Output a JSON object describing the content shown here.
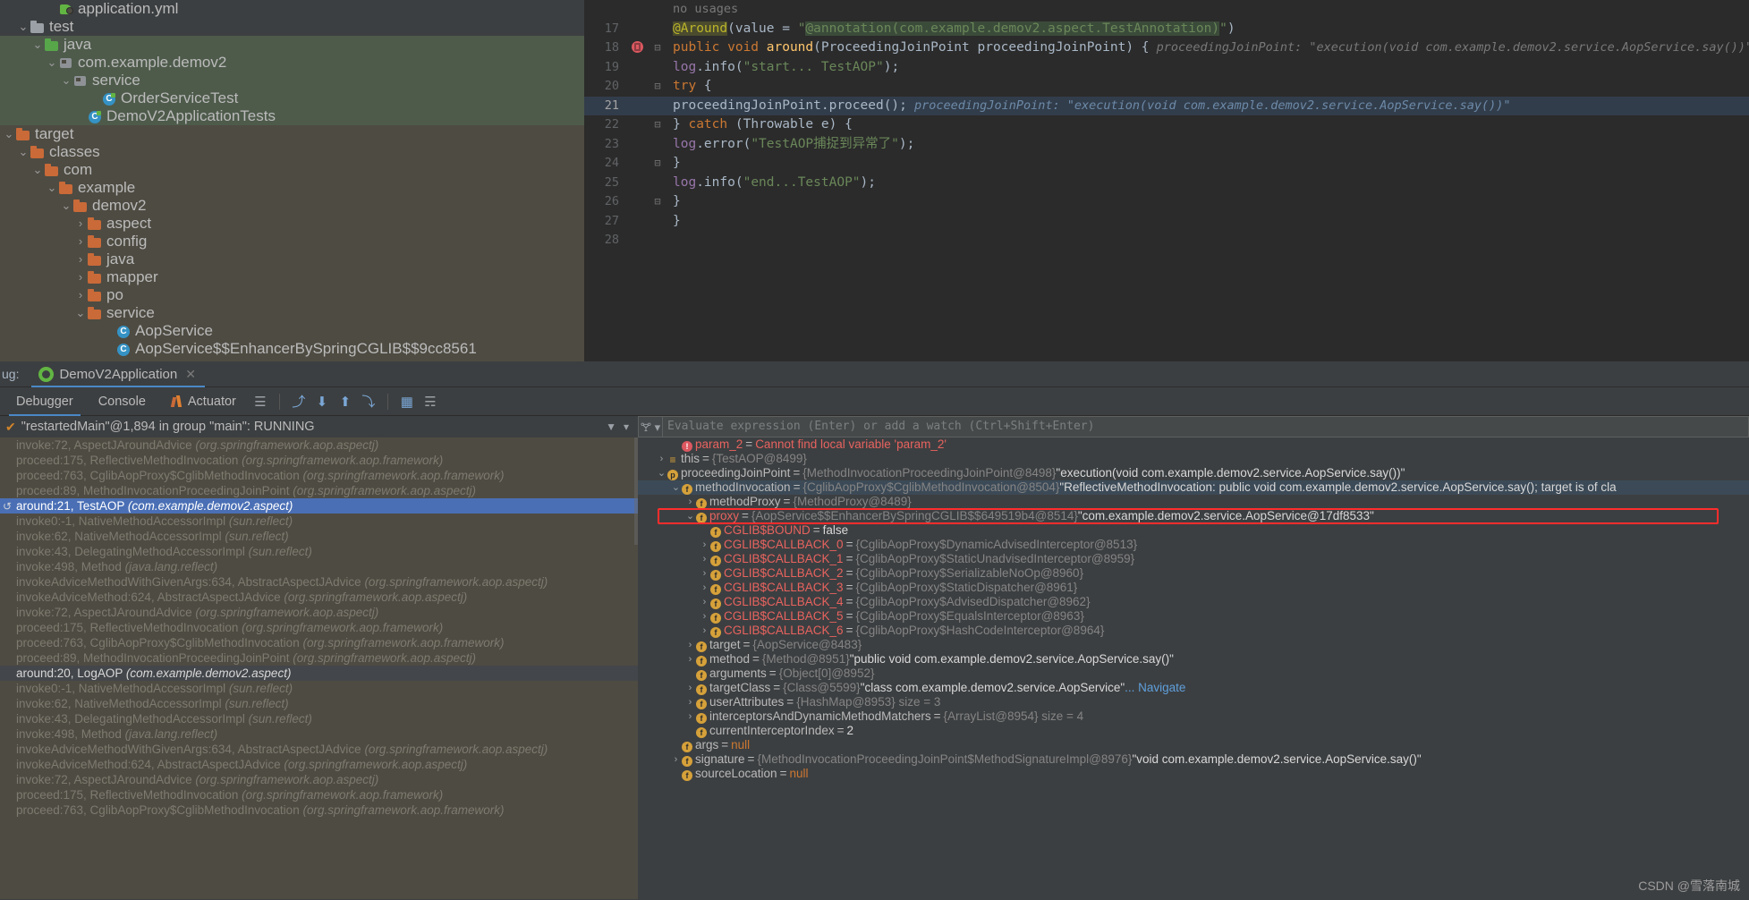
{
  "project_tree": [
    {
      "indent": 3,
      "icon": "yml-file-icon",
      "label": "application.yml",
      "chevron": "",
      "bg": "dark"
    },
    {
      "indent": 1,
      "icon": "folder-gray-icon",
      "label": "test",
      "chevron": "v",
      "bg": "dark"
    },
    {
      "indent": 2,
      "icon": "folder-green-icon",
      "label": "java",
      "chevron": "v",
      "bg": "green"
    },
    {
      "indent": 3,
      "icon": "package-icon",
      "label": "com.example.demov2",
      "chevron": "v",
      "bg": "green"
    },
    {
      "indent": 4,
      "icon": "package-icon",
      "label": "service",
      "chevron": "v",
      "bg": "green"
    },
    {
      "indent": 6,
      "icon": "class-test-icon",
      "label": "OrderServiceTest",
      "chevron": "",
      "bg": "green"
    },
    {
      "indent": 5,
      "icon": "class-test-icon",
      "label": "DemoV2ApplicationTests",
      "chevron": "",
      "bg": "green"
    },
    {
      "indent": 0,
      "icon": "folder-orange-icon",
      "label": "target",
      "chevron": "v",
      "bg": "brown"
    },
    {
      "indent": 1,
      "icon": "folder-orange-icon",
      "label": "classes",
      "chevron": "v",
      "bg": "brown"
    },
    {
      "indent": 2,
      "icon": "folder-orange-icon",
      "label": "com",
      "chevron": "v",
      "bg": "brown"
    },
    {
      "indent": 3,
      "icon": "folder-orange-icon",
      "label": "example",
      "chevron": "v",
      "bg": "brown"
    },
    {
      "indent": 4,
      "icon": "folder-orange-icon",
      "label": "demov2",
      "chevron": "v",
      "bg": "brown"
    },
    {
      "indent": 5,
      "icon": "folder-orange-icon",
      "label": "aspect",
      "chevron": ">",
      "bg": "brown"
    },
    {
      "indent": 5,
      "icon": "folder-orange-icon",
      "label": "config",
      "chevron": ">",
      "bg": "brown"
    },
    {
      "indent": 5,
      "icon": "folder-orange-icon",
      "label": "java",
      "chevron": ">",
      "bg": "brown"
    },
    {
      "indent": 5,
      "icon": "folder-orange-icon",
      "label": "mapper",
      "chevron": ">",
      "bg": "brown"
    },
    {
      "indent": 5,
      "icon": "folder-orange-icon",
      "label": "po",
      "chevron": ">",
      "bg": "brown"
    },
    {
      "indent": 5,
      "icon": "folder-orange-icon",
      "label": "service",
      "chevron": "v",
      "bg": "brown"
    },
    {
      "indent": 7,
      "icon": "class-icon",
      "label": "AopService",
      "chevron": "",
      "bg": "brown"
    },
    {
      "indent": 7,
      "icon": "class-icon",
      "label": "AopService$$EnhancerBySpringCGLIB$$9cc8561",
      "chevron": "",
      "bg": "brown"
    }
  ],
  "editor": {
    "no_usages_hint": "no usages",
    "lines": [
      {
        "num": "",
        "text_html": "",
        "kind": "hintline",
        "hint": "no usages"
      },
      {
        "num": "17",
        "kind": "code",
        "segments": [
          {
            "t": "@Around",
            "c": "anhl"
          },
          {
            "t": "(value = ",
            "c": "id"
          },
          {
            "t": "\"",
            "c": "s"
          },
          {
            "t": "@annotation(com.example.demov2.aspect.TestAnnotation)",
            "c": "s ann-hl"
          },
          {
            "t": "\"",
            "c": "s"
          },
          {
            "t": ")",
            "c": "id"
          }
        ]
      },
      {
        "num": "18",
        "kind": "code",
        "breakpoint": true,
        "fold": "-",
        "segments": [
          {
            "t": "public void ",
            "c": "k"
          },
          {
            "t": "around",
            "c": "fnd"
          },
          {
            "t": "(ProceedingJoinPoint proceedingJoinPoint) {",
            "c": "id"
          }
        ],
        "inlay": "proceedingJoinPoint: \"execution(void com.example.demov2.service.AopService.say())\""
      },
      {
        "num": "19",
        "kind": "code",
        "segments": [
          {
            "t": "    ",
            "c": "id"
          },
          {
            "t": "log",
            "c": "fld"
          },
          {
            "t": ".info(",
            "c": "id"
          },
          {
            "t": "\"start... TestAOP\"",
            "c": "s"
          },
          {
            "t": ");",
            "c": "id"
          }
        ]
      },
      {
        "num": "20",
        "kind": "code",
        "fold": "-",
        "segments": [
          {
            "t": "    ",
            "c": "id"
          },
          {
            "t": "try",
            "c": "k"
          },
          {
            "t": " {",
            "c": "id"
          }
        ]
      },
      {
        "num": "21",
        "kind": "code",
        "highlight": true,
        "segments": [
          {
            "t": "        proceedingJoinPoint.proceed();",
            "c": "id"
          }
        ],
        "inlay2": "proceedingJoinPoint: \"execution(void com.example.demov2.service.AopService.say())\""
      },
      {
        "num": "22",
        "kind": "code",
        "fold": "-",
        "segments": [
          {
            "t": "    } ",
            "c": "id"
          },
          {
            "t": "catch",
            "c": "k"
          },
          {
            "t": " (Throwable e) {",
            "c": "id"
          }
        ]
      },
      {
        "num": "23",
        "kind": "code",
        "segments": [
          {
            "t": "        ",
            "c": "id"
          },
          {
            "t": "log",
            "c": "fld"
          },
          {
            "t": ".error(",
            "c": "id"
          },
          {
            "t": "\"TestAOP捕捉到异常了\"",
            "c": "s"
          },
          {
            "t": ");",
            "c": "id"
          }
        ]
      },
      {
        "num": "24",
        "kind": "code",
        "fold": "-",
        "segments": [
          {
            "t": "    }",
            "c": "id"
          }
        ]
      },
      {
        "num": "25",
        "kind": "code",
        "segments": [
          {
            "t": "    ",
            "c": "id"
          },
          {
            "t": "log",
            "c": "fld"
          },
          {
            "t": ".info(",
            "c": "id"
          },
          {
            "t": "\"end...TestAOP\"",
            "c": "s"
          },
          {
            "t": ");",
            "c": "id"
          }
        ]
      },
      {
        "num": "26",
        "kind": "code",
        "fold": "-",
        "segments": [
          {
            "t": "}",
            "c": "id"
          }
        ]
      },
      {
        "num": "27",
        "kind": "code",
        "segments": [
          {
            "t": "}",
            "c": "id"
          }
        ]
      },
      {
        "num": "28",
        "kind": "code",
        "segments": [
          {
            "t": "",
            "c": "id"
          }
        ]
      }
    ]
  },
  "debug_panel": {
    "debug_label": "ug:",
    "tab_title": "DemoV2Application",
    "close_label": "✕",
    "subtabs": [
      {
        "label": "Debugger",
        "active": true
      },
      {
        "label": "Console",
        "active": false
      },
      {
        "label": "Actuator",
        "active": false,
        "icon": "actuator-icon"
      }
    ],
    "toolbar_buttons": [
      {
        "name": "frames-view-button",
        "glyph": "☰"
      },
      {
        "name": "step-over-button",
        "glyph": "⤴"
      },
      {
        "name": "step-into-button",
        "glyph": "⬇"
      },
      {
        "name": "step-out-button",
        "glyph": "⬆"
      },
      {
        "name": "run-to-cursor-button",
        "glyph": "⤵"
      },
      {
        "name": "evaluate-button",
        "glyph": "▦"
      },
      {
        "name": "settings-button",
        "glyph": "☴"
      }
    ],
    "thread_status": "\"restartedMain\"@1,894 in group \"main\": RUNNING",
    "frames": [
      {
        "method": "invoke:72, AspectJAroundAdvice",
        "pkg": "(org.springframework.aop.aspectj)",
        "state": "normal"
      },
      {
        "method": "proceed:175, ReflectiveMethodInvocation",
        "pkg": "(org.springframework.aop.framework)",
        "state": "normal"
      },
      {
        "method": "proceed:763, CglibAopProxy$CglibMethodInvocation",
        "pkg": "(org.springframework.aop.framework)",
        "state": "normal"
      },
      {
        "method": "proceed:89, MethodInvocationProceedingJoinPoint",
        "pkg": "(org.springframework.aop.aspectj)",
        "state": "normal"
      },
      {
        "method": "around:21, TestAOP",
        "pkg": "(com.example.demov2.aspect)",
        "state": "selected"
      },
      {
        "method": "invoke0:-1, NativeMethodAccessorImpl",
        "pkg": "(sun.reflect)",
        "state": "normal"
      },
      {
        "method": "invoke:62, NativeMethodAccessorImpl",
        "pkg": "(sun.reflect)",
        "state": "normal"
      },
      {
        "method": "invoke:43, DelegatingMethodAccessorImpl",
        "pkg": "(sun.reflect)",
        "state": "normal"
      },
      {
        "method": "invoke:498, Method",
        "pkg": "(java.lang.reflect)",
        "state": "normal"
      },
      {
        "method": "invokeAdviceMethodWithGivenArgs:634, AbstractAspectJAdvice",
        "pkg": "(org.springframework.aop.aspectj)",
        "state": "normal"
      },
      {
        "method": "invokeAdviceMethod:624, AbstractAspectJAdvice",
        "pkg": "(org.springframework.aop.aspectj)",
        "state": "normal"
      },
      {
        "method": "invoke:72, AspectJAroundAdvice",
        "pkg": "(org.springframework.aop.aspectj)",
        "state": "normal"
      },
      {
        "method": "proceed:175, ReflectiveMethodInvocation",
        "pkg": "(org.springframework.aop.framework)",
        "state": "normal"
      },
      {
        "method": "proceed:763, CglibAopProxy$CglibMethodInvocation",
        "pkg": "(org.springframework.aop.framework)",
        "state": "normal"
      },
      {
        "method": "proceed:89, MethodInvocationProceedingJoinPoint",
        "pkg": "(org.springframework.aop.aspectj)",
        "state": "normal"
      },
      {
        "method": "around:20, LogAOP",
        "pkg": "(com.example.demov2.aspect)",
        "state": "hover"
      },
      {
        "method": "invoke0:-1, NativeMethodAccessorImpl",
        "pkg": "(sun.reflect)",
        "state": "normal"
      },
      {
        "method": "invoke:62, NativeMethodAccessorImpl",
        "pkg": "(sun.reflect)",
        "state": "normal"
      },
      {
        "method": "invoke:43, DelegatingMethodAccessorImpl",
        "pkg": "(sun.reflect)",
        "state": "normal"
      },
      {
        "method": "invoke:498, Method",
        "pkg": "(java.lang.reflect)",
        "state": "normal"
      },
      {
        "method": "invokeAdviceMethodWithGivenArgs:634, AbstractAspectJAdvice",
        "pkg": "(org.springframework.aop.aspectj)",
        "state": "normal"
      },
      {
        "method": "invokeAdviceMethod:624, AbstractAspectJAdvice",
        "pkg": "(org.springframework.aop.aspectj)",
        "state": "normal"
      },
      {
        "method": "invoke:72, AspectJAroundAdvice",
        "pkg": "(org.springframework.aop.aspectj)",
        "state": "normal"
      },
      {
        "method": "proceed:175, ReflectiveMethodInvocation",
        "pkg": "(org.springframework.aop.framework)",
        "state": "normal"
      },
      {
        "method": "proceed:763, CglibAopProxy$CglibMethodInvocation",
        "pkg": "(org.springframework.aop.framework)",
        "state": "normal"
      }
    ],
    "evaluate_placeholder": "Evaluate expression (Enter) or add a watch (Ctrl+Shift+Enter)",
    "variables": [
      {
        "indent": 1,
        "chevron": "",
        "badge": "err",
        "badge_char": "!",
        "name": "param_2",
        "name_red": true,
        "eq": "=",
        "value": "Cannot find local variable 'param_2'",
        "value_class": "vname red"
      },
      {
        "indent": 0,
        "chevron": ">",
        "badge": "this",
        "badge_char": "≡",
        "name": "this",
        "eq": "=",
        "value": "{TestAOP@8499}",
        "value_class": "vval"
      },
      {
        "indent": 0,
        "chevron": "v",
        "badge": "p",
        "badge_char": "p",
        "name": "proceedingJoinPoint",
        "eq": "=",
        "value": "{MethodInvocationProceedingJoinPoint@8498}",
        "value_class": "vval",
        "str": "\"execution(void com.example.demov2.service.AopService.say())\""
      },
      {
        "indent": 1,
        "chevron": "v",
        "badge": "f",
        "badge_char": "f",
        "name": "methodInvocation",
        "eq": "=",
        "value": "{CglibAopProxy$CglibMethodInvocation@8504}",
        "value_class": "vval",
        "str": "\"ReflectiveMethodInvocation: public void com.example.demov2.service.AopService.say(); target is of cla",
        "selected": true
      },
      {
        "indent": 2,
        "chevron": ">",
        "badge": "f",
        "badge_char": "f",
        "name": "methodProxy",
        "eq": "=",
        "value": "{MethodProxy@8489}",
        "value_class": "vval"
      },
      {
        "indent": 2,
        "chevron": "v",
        "badge": "f",
        "badge_char": "f",
        "name": "proxy",
        "name_red": true,
        "eq": "=",
        "value": "{AopService$$EnhancerBySpringCGLIB$$649519b4@8514}",
        "value_class": "vval",
        "str": "\"com.example.demov2.service.AopService@17df8533\"",
        "boxed": true
      },
      {
        "indent": 3,
        "chevron": "",
        "badge": "f",
        "badge_char": "f",
        "name": "CGLIB$BOUND",
        "name_red": true,
        "eq": "=",
        "value": "false",
        "value_class": "vstr"
      },
      {
        "indent": 3,
        "chevron": ">",
        "badge": "f",
        "badge_char": "f",
        "name": "CGLIB$CALLBACK_0",
        "name_red": true,
        "eq": "=",
        "value": "{CglibAopProxy$DynamicAdvisedInterceptor@8513}",
        "value_class": "vval"
      },
      {
        "indent": 3,
        "chevron": ">",
        "badge": "f",
        "badge_char": "f",
        "name": "CGLIB$CALLBACK_1",
        "name_red": true,
        "eq": "=",
        "value": "{CglibAopProxy$StaticUnadvisedInterceptor@8959}",
        "value_class": "vval"
      },
      {
        "indent": 3,
        "chevron": ">",
        "badge": "f",
        "badge_char": "f",
        "name": "CGLIB$CALLBACK_2",
        "name_red": true,
        "eq": "=",
        "value": "{CglibAopProxy$SerializableNoOp@8960}",
        "value_class": "vval"
      },
      {
        "indent": 3,
        "chevron": ">",
        "badge": "f",
        "badge_char": "f",
        "name": "CGLIB$CALLBACK_3",
        "name_red": true,
        "eq": "=",
        "value": "{CglibAopProxy$StaticDispatcher@8961}",
        "value_class": "vval"
      },
      {
        "indent": 3,
        "chevron": ">",
        "badge": "f",
        "badge_char": "f",
        "name": "CGLIB$CALLBACK_4",
        "name_red": true,
        "eq": "=",
        "value": "{CglibAopProxy$AdvisedDispatcher@8962}",
        "value_class": "vval"
      },
      {
        "indent": 3,
        "chevron": ">",
        "badge": "f",
        "badge_char": "f",
        "name": "CGLIB$CALLBACK_5",
        "name_red": true,
        "eq": "=",
        "value": "{CglibAopProxy$EqualsInterceptor@8963}",
        "value_class": "vval"
      },
      {
        "indent": 3,
        "chevron": ">",
        "badge": "f",
        "badge_char": "f",
        "name": "CGLIB$CALLBACK_6",
        "name_red": true,
        "eq": "=",
        "value": "{CglibAopProxy$HashCodeInterceptor@8964}",
        "value_class": "vval"
      },
      {
        "indent": 2,
        "chevron": ">",
        "badge": "f",
        "badge_char": "f",
        "name": "target",
        "eq": "=",
        "value": "{AopService@8483}",
        "value_class": "vval"
      },
      {
        "indent": 2,
        "chevron": ">",
        "badge": "f",
        "badge_char": "f",
        "name": "method",
        "eq": "=",
        "value": "{Method@8951}",
        "value_class": "vval",
        "str": "\"public void com.example.demov2.service.AopService.say()\""
      },
      {
        "indent": 2,
        "chevron": "",
        "badge": "f",
        "badge_char": "f",
        "name": "arguments",
        "eq": "=",
        "value": "{Object[0]@8952}",
        "value_class": "vval"
      },
      {
        "indent": 2,
        "chevron": ">",
        "badge": "f",
        "badge_char": "f",
        "name": "targetClass",
        "eq": "=",
        "value": "{Class@5599}",
        "value_class": "vval",
        "str": "\"class com.example.demov2.service.AopService\"",
        "nav": "... Navigate"
      },
      {
        "indent": 2,
        "chevron": ">",
        "badge": "f",
        "badge_char": "f",
        "name": "userAttributes",
        "eq": "=",
        "value": "{HashMap@8953}  size = 3",
        "value_class": "vval"
      },
      {
        "indent": 2,
        "chevron": ">",
        "badge": "f",
        "badge_char": "f",
        "name": "interceptorsAndDynamicMethodMatchers",
        "eq": "=",
        "value": "{ArrayList@8954}  size = 4",
        "value_class": "vval"
      },
      {
        "indent": 2,
        "chevron": "",
        "badge": "f",
        "badge_char": "f",
        "name": "currentInterceptorIndex",
        "eq": "=",
        "value": "2",
        "value_class": "vstr"
      },
      {
        "indent": 1,
        "chevron": "",
        "badge": "f",
        "badge_char": "f",
        "name": "args",
        "eq": "=",
        "value": "null",
        "value_class": "vnull"
      },
      {
        "indent": 1,
        "chevron": ">",
        "badge": "f",
        "badge_char": "f",
        "name": "signature",
        "eq": "=",
        "value": "{MethodInvocationProceedingJoinPoint$MethodSignatureImpl@8976}",
        "value_class": "vval",
        "str": "\"void com.example.demov2.service.AopService.say()\""
      },
      {
        "indent": 1,
        "chevron": "",
        "badge": "f",
        "badge_char": "f",
        "name": "sourceLocation",
        "eq": "=",
        "value": "null",
        "value_class": "vnull"
      }
    ]
  },
  "watermark": "CSDN @雪落南城",
  "colors": {
    "accent_blue": "#4a88c7",
    "selection_blue": "#4a6fb5",
    "highlight_red": "#ff2d2d",
    "editor_bg": "#2b2b2b",
    "panel_bg": "#3c3f41",
    "tree_bg": "#4e4b42"
  }
}
